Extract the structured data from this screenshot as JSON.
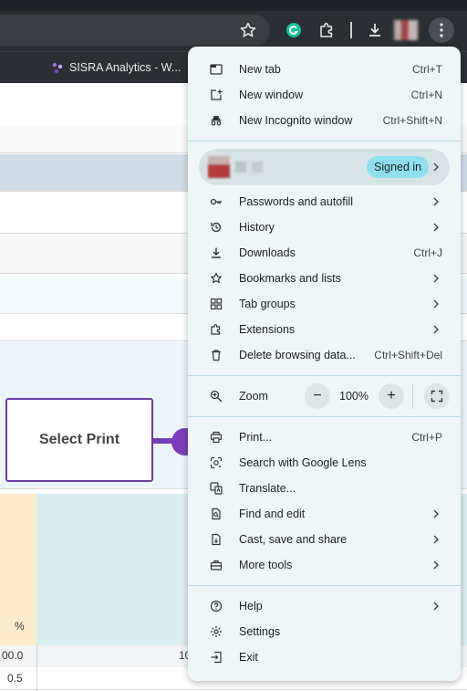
{
  "bookmark": {
    "label": "SISRA Analytics - W..."
  },
  "callout": {
    "text": "Select Print"
  },
  "sheet": {
    "cells": [
      "%",
      "00.0",
      "10",
      "0.5"
    ]
  },
  "menu": {
    "section1": [
      {
        "label": "New tab",
        "shortcut": "Ctrl+T"
      },
      {
        "label": "New window",
        "shortcut": "Ctrl+N"
      },
      {
        "label": "New Incognito window",
        "shortcut": "Ctrl+Shift+N"
      }
    ],
    "profile": {
      "badge": "Signed in"
    },
    "section2": [
      {
        "label": "Passwords and autofill",
        "shortcut": ""
      },
      {
        "label": "History",
        "shortcut": ""
      },
      {
        "label": "Downloads",
        "shortcut": "Ctrl+J"
      },
      {
        "label": "Bookmarks and lists",
        "shortcut": ""
      },
      {
        "label": "Tab groups",
        "shortcut": ""
      },
      {
        "label": "Extensions",
        "shortcut": ""
      },
      {
        "label": "Delete browsing data...",
        "shortcut": "Ctrl+Shift+Del"
      }
    ],
    "zoom": {
      "label": "Zoom",
      "minus": "−",
      "value": "100%",
      "plus": "+"
    },
    "section3": [
      {
        "label": "Print...",
        "shortcut": "Ctrl+P"
      },
      {
        "label": "Search with Google Lens",
        "shortcut": ""
      },
      {
        "label": "Translate...",
        "shortcut": ""
      },
      {
        "label": "Find and edit",
        "shortcut": ""
      },
      {
        "label": "Cast, save and share",
        "shortcut": ""
      },
      {
        "label": "More tools",
        "shortcut": ""
      }
    ],
    "section4": [
      {
        "label": "Help",
        "shortcut": ""
      },
      {
        "label": "Settings",
        "shortcut": ""
      },
      {
        "label": "Exit",
        "shortcut": ""
      }
    ]
  },
  "colors": {
    "menu_bg": "#eef6f8",
    "accent": "#7a3fb8",
    "signed_in_badge": "#8fe0ef"
  }
}
